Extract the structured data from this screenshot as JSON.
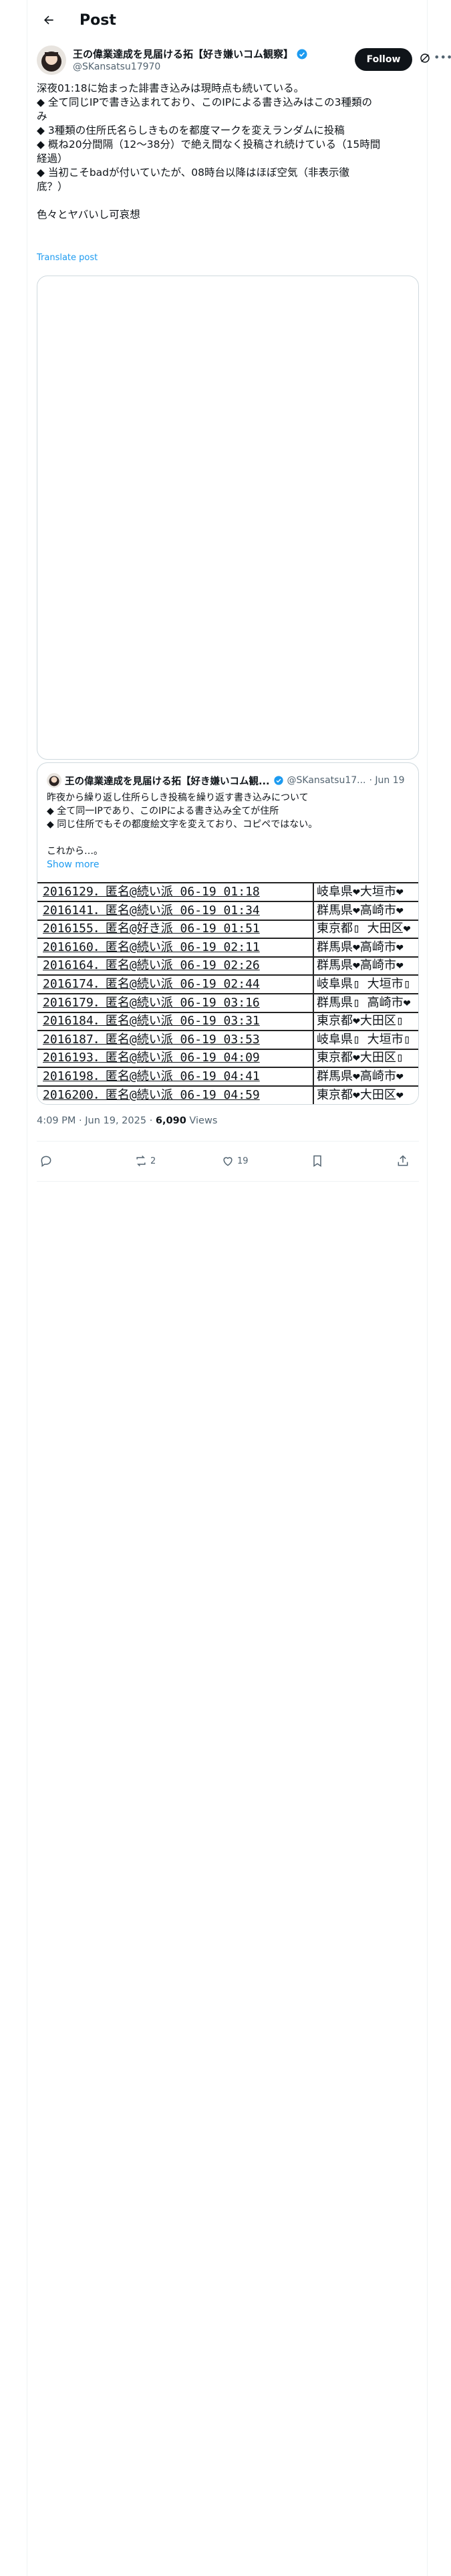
{
  "header": {
    "title": "Post"
  },
  "author": {
    "name": "王の偉業達成を見届ける拓【好き嫌いコム観察】",
    "handle": "@SKansatsu17970",
    "follow_label": "Follow"
  },
  "tweet": {
    "lines": [
      "深夜01:18に始まった誹書き込みは現時点も続いている。",
      "◆ 全て同じIPで書き込まれており、このIPによる書き込みはこの3種類の",
      "み",
      "◆ 3種類の住所氏名らしきものを都度マークを変えランダムに投稿",
      "◆ 概ね20分間隔（12〜38分）で絶え間なく投稿され続けている（15時間",
      "経過）",
      "◆ 当初こそbadが付いていたが、08時台以降はほぼ空気（非表示徹",
      "底？）",
      "",
      "色々とヤバいし可哀想"
    ],
    "translate_label": "Translate post"
  },
  "quote": {
    "name": "王の偉業達成を見届ける拓【好き嫌いコム観...",
    "handle": "@SKansatsu17...",
    "date": "· Jun 19",
    "lines": [
      "昨夜から繰り返し住所らしき投稿を繰り返す書き込みについて",
      "◆ 全て同一IPであり、このIPによる書き込み全てが住所",
      "◆ 同じ住所でもその都度絵文字を変えており、コピペではない。",
      "",
      "これから…。"
    ],
    "show_more": "Show more",
    "receipt_rows": [
      {
        "left": "2016129．匿名@続い派 06-19 01:18",
        "right": "岐阜県❤大垣市❤"
      },
      {
        "left": "2016141．匿名@続い派 06-19 01:34",
        "right": "群馬県❤高崎市❤"
      },
      {
        "left": "2016155．匿名@好き派 06-19 01:51",
        "right": "東京都▯ 大田区❤"
      },
      {
        "left": "2016160．匿名@続い派 06-19 02:11",
        "right": "群馬県❤高崎市❤"
      },
      {
        "left": "2016164．匿名@続い派 06-19 02:26",
        "right": "群馬県❤高崎市❤"
      },
      {
        "left": "2016174．匿名@続い派 06-19 02:44",
        "right": "岐阜県▯ 大垣市▯"
      },
      {
        "left": "2016179．匿名@続い派 06-19 03:16",
        "right": "群馬県▯ 高崎市❤"
      },
      {
        "left": "2016184．匿名@続い派 06-19 03:31",
        "right": "東京都❤大田区▯"
      },
      {
        "left": "2016187．匿名@続い派 06-19 03:53",
        "right": "岐阜県▯ 大垣市▯"
      },
      {
        "left": "2016193．匿名@続い派 06-19 04:09",
        "right": "東京都❤大田区▯"
      },
      {
        "left": "2016198．匿名@続い派 06-19 04:41",
        "right": "群馬県❤高崎市❤"
      },
      {
        "left": "2016200．匿名@続い派 06-19 04:59",
        "right": "東京都❤大田区❤"
      }
    ]
  },
  "meta": {
    "time": "4:09 PM · Jun 19, 2025 · ",
    "views_count": "6,090",
    "views_label": " Views"
  },
  "actions": {
    "reposts": "2",
    "likes": "19"
  },
  "colors": {
    "accent": "#1d9bf0",
    "text": "#0f1419",
    "muted": "#536471",
    "border": "#cfd9de"
  },
  "icons": [
    "back-arrow-icon",
    "verified-badge-icon",
    "grok-icon",
    "more-icon",
    "reply-icon",
    "repost-icon",
    "like-icon",
    "bookmark-icon",
    "share-icon"
  ]
}
